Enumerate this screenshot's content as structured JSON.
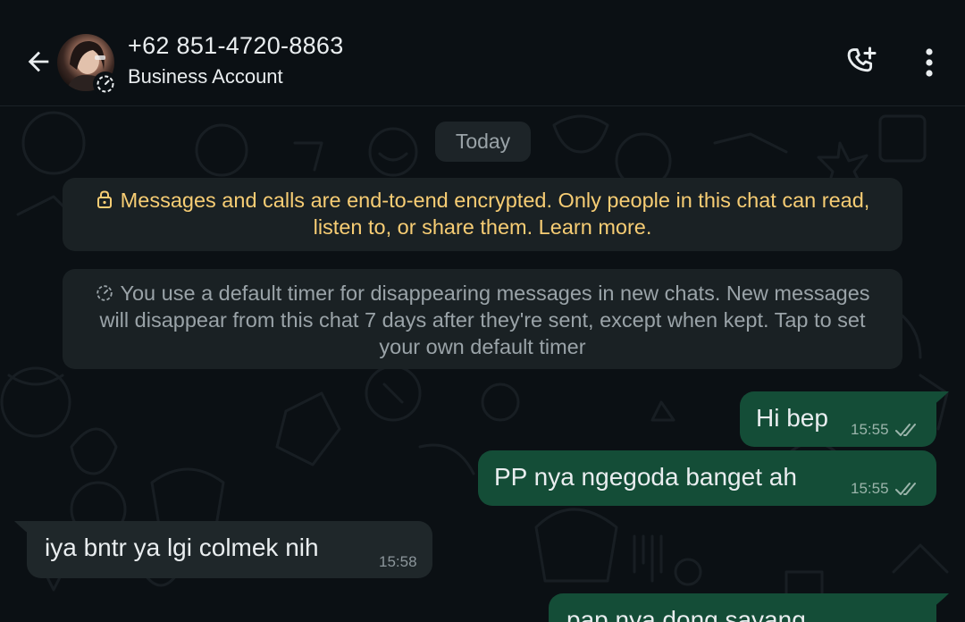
{
  "header": {
    "contact_name": "+62 851-4720-8863",
    "subtitle": "Business Account",
    "icons": {
      "back": "arrow-left-icon",
      "call": "add-call-icon",
      "menu": "more-vertical-icon",
      "avatar_badge": "disappearing-timer-icon"
    }
  },
  "chat": {
    "date_chip": "Today",
    "encryption_notice": "Messages and calls are end-to-end encrypted. Only people in this chat can read, listen to, or share them. Learn more.",
    "timer_notice": "You use a default timer for disappearing messages in new chats. New messages will disappear from this chat 7 days after they're sent, except when kept. Tap to set your own default timer",
    "messages": [
      {
        "direction": "out",
        "text": "Hi bep",
        "time": "15:55",
        "status": "read"
      },
      {
        "direction": "out",
        "text": "PP nya ngegoda banget ah",
        "time": "15:55",
        "status": "read"
      },
      {
        "direction": "in",
        "text": "iya bntr ya lgi colmek nih",
        "time": "15:58"
      },
      {
        "direction": "out",
        "text": "pap nya dong sayang",
        "time": "",
        "status": ""
      }
    ]
  },
  "colors": {
    "background": "#0b1014",
    "outgoing_bubble": "#144d37",
    "incoming_bubble": "#1f272a",
    "notice_bg": "#1a2124",
    "encryption_text": "#f7cd74",
    "secondary_text": "#9aa3a8",
    "primary_text": "#e9edef"
  }
}
